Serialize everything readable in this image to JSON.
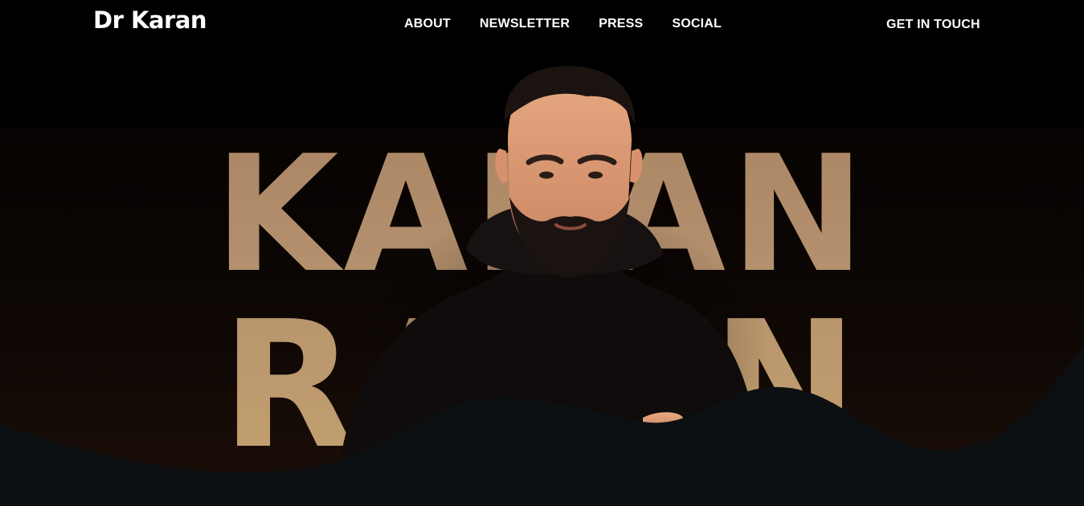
{
  "brand": {
    "name": "Dr Karan"
  },
  "nav": {
    "items": [
      {
        "label": "ABOUT"
      },
      {
        "label": "NEWSLETTER"
      },
      {
        "label": "PRESS"
      },
      {
        "label": "SOCIAL"
      }
    ],
    "cta_label": "GET IN TOUCH"
  },
  "hero": {
    "first_name": "KARAN",
    "last_name": "RAJAN",
    "colors": {
      "background": "#000000",
      "text_gradient_top": "#ab8665",
      "text_gradient_bottom": "#c2a06e",
      "wave": "#0d1013"
    }
  }
}
